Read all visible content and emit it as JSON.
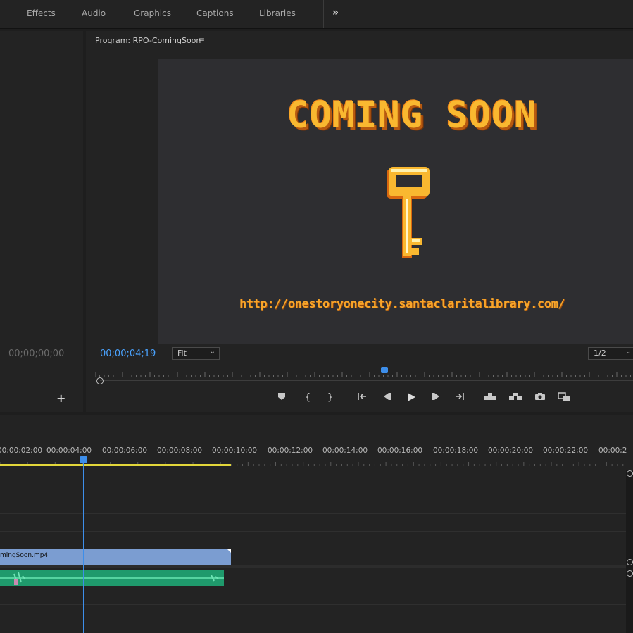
{
  "workspace_tabs": [
    "Effects",
    "Audio",
    "Graphics",
    "Captions",
    "Libraries"
  ],
  "workspace_more": "»",
  "left_panel": {
    "timecode": "00;00;00;00",
    "add_label": "+"
  },
  "program_monitor": {
    "title": "Program: RPO-ComingSoon",
    "menu_icon": "≡",
    "video": {
      "headline": "COMING SOON",
      "url": "http://onestoryonecity.santaclaritalibrary.com/"
    },
    "timecode": "00;00;04;19",
    "zoom": "Fit",
    "resolution": "1/2",
    "playhead_fraction": 0.54
  },
  "transport_buttons": [
    {
      "name": "add-marker-button",
      "glyph": "⬟"
    },
    {
      "name": "mark-in-button",
      "glyph": "{"
    },
    {
      "name": "mark-out-button",
      "glyph": "}"
    },
    {
      "name": "go-to-in-button",
      "glyph": "{←"
    },
    {
      "name": "step-back-button",
      "glyph": "◀|"
    },
    {
      "name": "play-button",
      "glyph": "▶"
    },
    {
      "name": "step-forward-button",
      "glyph": "|▶"
    },
    {
      "name": "go-to-out-button",
      "glyph": "→}"
    },
    {
      "name": "lift-button",
      "glyph": "⊓"
    },
    {
      "name": "extract-button",
      "glyph": "⊔"
    },
    {
      "name": "export-frame-button",
      "glyph": "◙"
    },
    {
      "name": "comparison-view-button",
      "glyph": "▣"
    }
  ],
  "timeline": {
    "ruler_labels": [
      "00;00;02;00",
      "00;00;04;00",
      "00;00;06;00",
      "00;00;08;00",
      "00;00;10;00",
      "00;00;12;00",
      "00;00;14;00",
      "00;00;16;00",
      "00;00;18;00",
      "00;00;20;00",
      "00;00;22;00",
      "00;00;2"
    ],
    "video_clip_label": "mingSoon.mp4"
  },
  "colors": {
    "accent_blue": "#3d8eea",
    "work_area": "#e2d63a",
    "video_clip": "#7b9dd1",
    "audio_clip": "#1f9a6c",
    "title_orange": "#f9b830"
  }
}
